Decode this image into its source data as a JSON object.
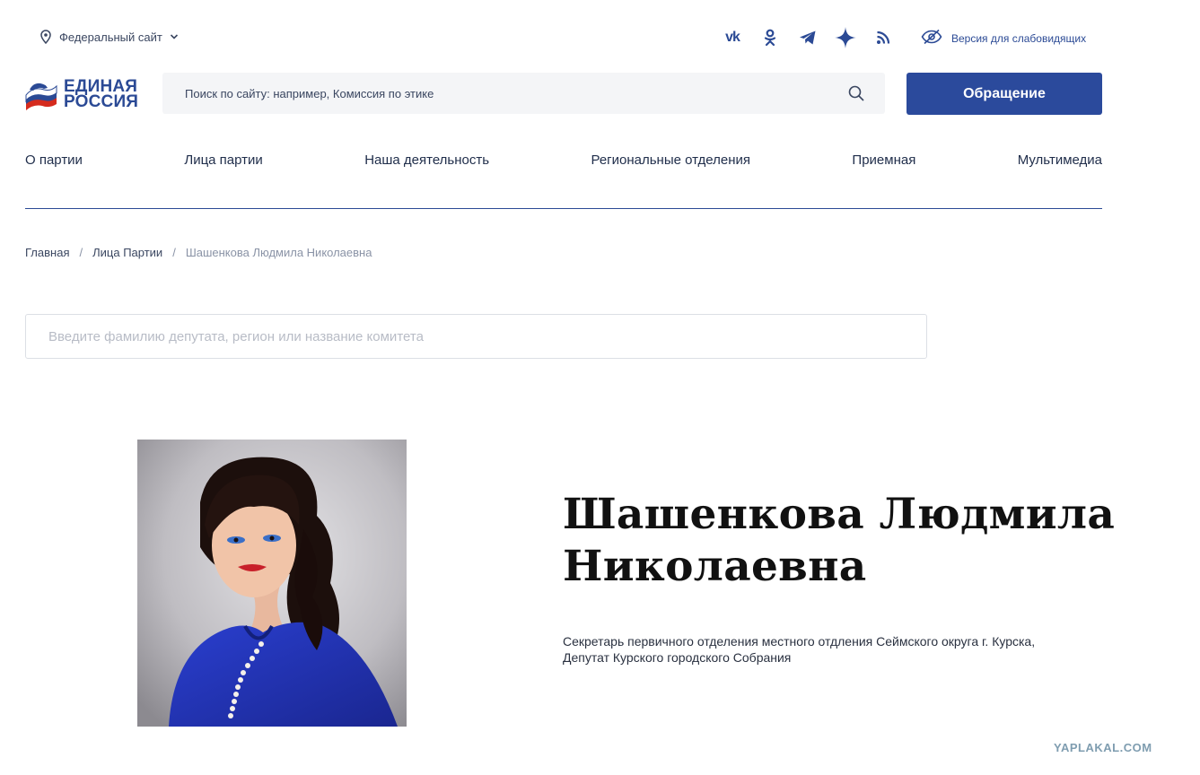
{
  "topbar": {
    "region_label": "Федеральный сайт",
    "socials": [
      {
        "icon": "vk-icon",
        "glyph": "vk"
      },
      {
        "icon": "odnoklassniki-icon",
        "glyph": ""
      },
      {
        "icon": "telegram-icon",
        "glyph": ""
      },
      {
        "icon": "sparkle-icon",
        "glyph": ""
      },
      {
        "icon": "rss-icon",
        "glyph": ""
      }
    ],
    "a11y_label": "Версия для слабовидящих"
  },
  "header": {
    "logo_line1": "ЕДИНАЯ",
    "logo_line2": "РОССИЯ",
    "search_placeholder": "Поиск по сайту: например, Комиссия по этике",
    "appeal_label": "Обращение"
  },
  "nav": {
    "items": [
      "О партии",
      "Лица партии",
      "Наша деятельность",
      "Региональные отделения",
      "Приемная",
      "Мультимедиа"
    ]
  },
  "breadcrumb": {
    "home": "Главная",
    "section": "Лица Партии",
    "current": "Шашенкова Людмила Николаевна",
    "separator": "/"
  },
  "deputy_search": {
    "placeholder": "Введите фамилию депутата, регион или название комитета"
  },
  "profile": {
    "name_line1": "Шашенкова Людмила",
    "name_line2": "Николаевна",
    "position_line1": "Секретарь первичного отделения местного отдления Сеймского округа г. Курска,",
    "position_line2": "Депутат Курского городского Собрания"
  },
  "watermark": "YAPLAKAL.COM",
  "colors": {
    "brand_blue": "#2b4a9c",
    "text_dark": "#1f2d4a",
    "divider": "#2b4a95"
  }
}
